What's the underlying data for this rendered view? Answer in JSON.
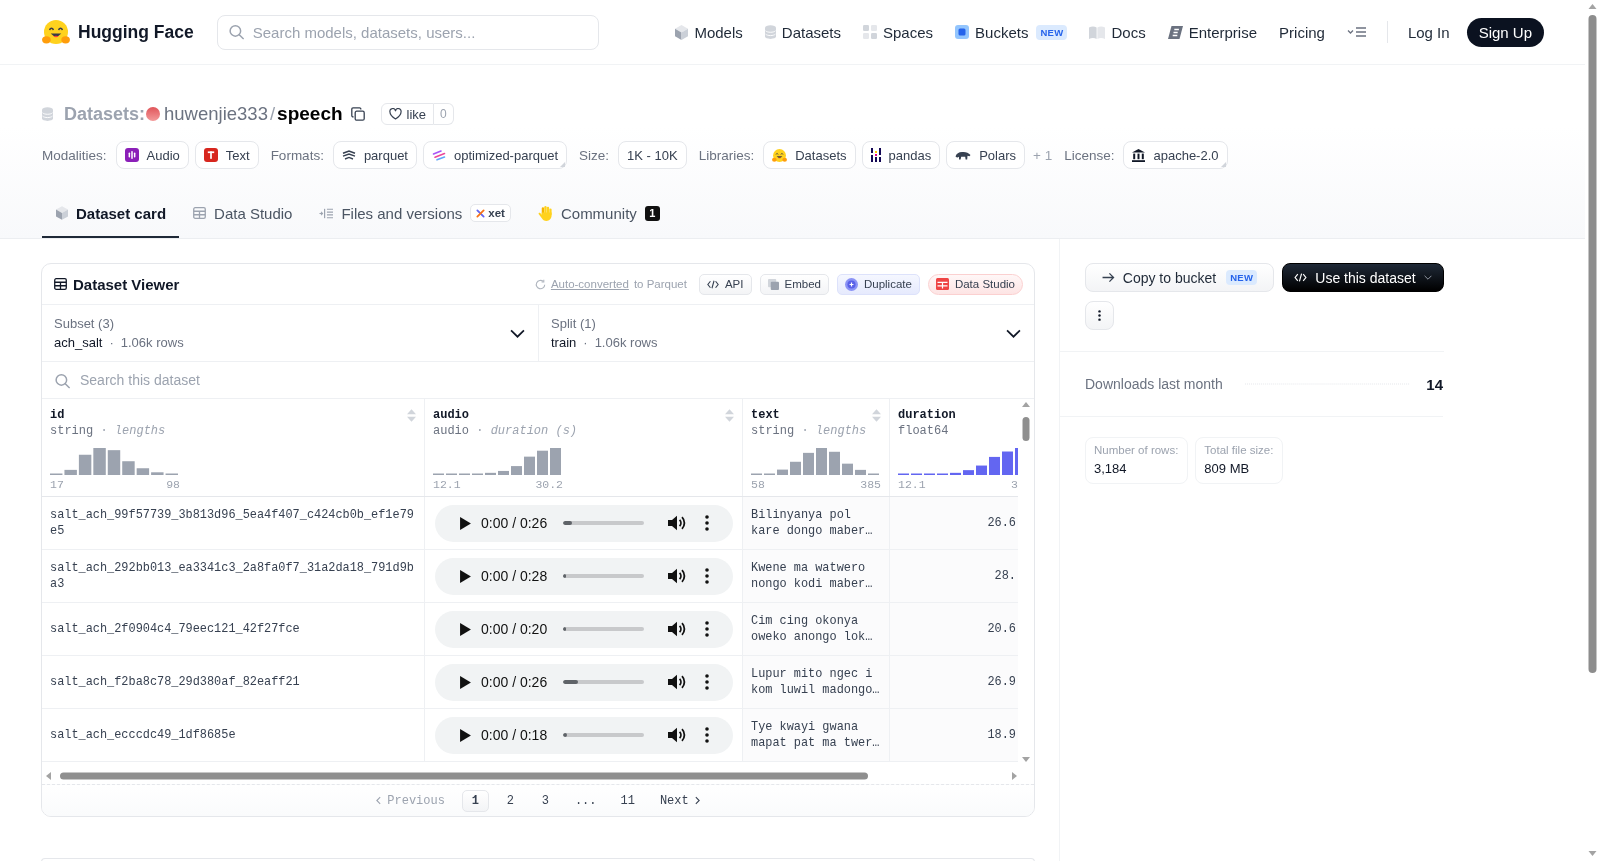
{
  "header": {
    "brand": "Hugging Face",
    "search": {
      "placeholder": "Search models, datasets, users..."
    },
    "nav": [
      {
        "label": "Models",
        "kind": "models"
      },
      {
        "label": "Datasets",
        "kind": "datasets"
      },
      {
        "label": "Spaces",
        "kind": "spaces"
      },
      {
        "label": "Buckets",
        "kind": "buckets",
        "badge": "NEW"
      },
      {
        "label": "Docs",
        "kind": "docs"
      },
      {
        "label": "Enterprise",
        "kind": "enterprise"
      },
      {
        "label": "Pricing",
        "kind": "plain"
      }
    ],
    "login": "Log In",
    "signup": "Sign Up"
  },
  "repo": {
    "section": "Datasets:",
    "owner": "huwenjie333",
    "separator": "/",
    "name": "speech",
    "like": {
      "label": "like",
      "count": "0"
    }
  },
  "meta": [
    {
      "label": "Modalities:",
      "tags": [
        {
          "label": "Audio",
          "kind": "audio",
          "expandable": false
        },
        {
          "label": "Text",
          "kind": "text",
          "expandable": false
        }
      ]
    },
    {
      "label": "Formats:",
      "tags": [
        {
          "label": "parquet",
          "kind": "parquet",
          "expandable": false
        },
        {
          "label": "optimized-parquet",
          "kind": "optimized",
          "expandable": true
        }
      ]
    },
    {
      "label": "Size:",
      "tags": [
        {
          "label": "1K - 10K",
          "kind": "plain",
          "expandable": false
        }
      ]
    },
    {
      "label": "Libraries:",
      "tags": [
        {
          "label": "Datasets",
          "kind": "hf",
          "expandable": false
        },
        {
          "label": "pandas",
          "kind": "pandas",
          "expandable": false
        },
        {
          "label": "Polars",
          "kind": "polars",
          "expandable": false
        }
      ],
      "more": "+ 1"
    },
    {
      "label": "License:",
      "tags": [
        {
          "label": "apache-2.0",
          "kind": "license",
          "expandable": true
        }
      ]
    }
  ],
  "tabs": [
    {
      "label": "Dataset card",
      "kind": "card",
      "selected": true
    },
    {
      "label": "Data Studio",
      "kind": "table",
      "selected": false
    },
    {
      "label": "Files and versions",
      "kind": "files",
      "selected": false,
      "badge": "xet"
    },
    {
      "label": "Community",
      "kind": "community",
      "selected": false,
      "count": "1"
    }
  ],
  "viewer": {
    "title": "Dataset Viewer",
    "conversion": {
      "link": "Auto-converted",
      "text": "to Parquet"
    },
    "actions": [
      {
        "label": "API",
        "kind": "api"
      },
      {
        "label": "Embed",
        "kind": "embed"
      },
      {
        "label": "Duplicate",
        "kind": "duplicate"
      },
      {
        "label": "Data Studio",
        "kind": "studio"
      }
    ],
    "selectors": [
      {
        "label": "Subset (3)",
        "value": "ach_salt",
        "separator": "·",
        "rows": "1.06k rows"
      },
      {
        "label": "Split (1)",
        "value": "train",
        "separator": "·",
        "rows": "1.06k rows"
      }
    ],
    "search": {
      "placeholder": "Search this dataset"
    },
    "columns": [
      {
        "name": "id",
        "type": "string",
        "separator": "·",
        "stat": "lengths",
        "min": "17",
        "max": "98",
        "kind": "id",
        "sortable": true
      },
      {
        "name": "audio",
        "type": "audio",
        "separator": "·",
        "stat": "duration (s)",
        "min": "12.1",
        "max": "30.2",
        "kind": "audio",
        "sortable": true
      },
      {
        "name": "text",
        "type": "string",
        "separator": "·",
        "stat": "lengths",
        "min": "58",
        "max": "385",
        "kind": "text",
        "sortable": true
      },
      {
        "name": "duration",
        "type": "float64",
        "min": "12.1",
        "max": "3",
        "kind": "number",
        "sortable": false
      }
    ],
    "rows": [
      {
        "cells": [
          {
            "text": "salt_ach_99f57739_3b813d96_5ea4f407_c424cb0b_ef1e79e5"
          },
          {
            "time": "0:00 / 0:26",
            "level": 0.11
          },
          {
            "text": "Bilinyanya pol kare dongo maber…"
          },
          {
            "text": "26.6"
          }
        ]
      },
      {
        "cells": [
          {
            "text": "salt_ach_292bb013_ea3341c3_2a8fa0f7_31a2da18_791d9ba3"
          },
          {
            "time": "0:00 / 0:28",
            "level": 0.03
          },
          {
            "text": "Kwene ma watwero nongo kodi maber…"
          },
          {
            "text": "28."
          }
        ]
      },
      {
        "cells": [
          {
            "text": "salt_ach_2f0904c4_79eec121_42f27fce"
          },
          {
            "time": "0:00 / 0:20",
            "level": 0.03
          },
          {
            "text": "Cim cing okonya oweko anongo lok…"
          },
          {
            "text": "20.6"
          }
        ]
      },
      {
        "cells": [
          {
            "text": "salt_ach_f2ba8c78_29d380af_82eaff21"
          },
          {
            "time": "0:00 / 0:26",
            "level": 0.18
          },
          {
            "text": "Lupur mito ngec i kom luwil madongo…"
          },
          {
            "text": "26.9"
          }
        ]
      },
      {
        "cells": [
          {
            "text": "salt_ach_ecccdc49_1df8685e"
          },
          {
            "time": "0:00 / 0:18",
            "level": 0.05
          },
          {
            "text": "Tye kwayi gwana mapat pat ma twer…"
          },
          {
            "text": "18.9"
          }
        ]
      }
    ],
    "pagination": {
      "previous": {
        "label": "Previous",
        "disabled": true
      },
      "pages": [
        {
          "label": "1",
          "selected": true
        },
        {
          "label": "2",
          "selected": false
        },
        {
          "label": "3",
          "selected": false
        },
        {
          "label": "...",
          "selected": false
        },
        {
          "label": "11",
          "selected": false
        }
      ],
      "next": {
        "label": "Next",
        "disabled": false
      }
    }
  },
  "sidebar": {
    "actions": [
      {
        "label": "Copy to bucket",
        "kind": "copy",
        "badge": "NEW"
      },
      {
        "label": "Use this dataset",
        "kind": "use"
      }
    ],
    "downloads": {
      "label": "Downloads last month",
      "value": "14"
    },
    "stats": [
      {
        "label": "Number of rows:",
        "value": "3,184"
      },
      {
        "label": "Total file size:",
        "value": "809 MB"
      }
    ]
  }
}
